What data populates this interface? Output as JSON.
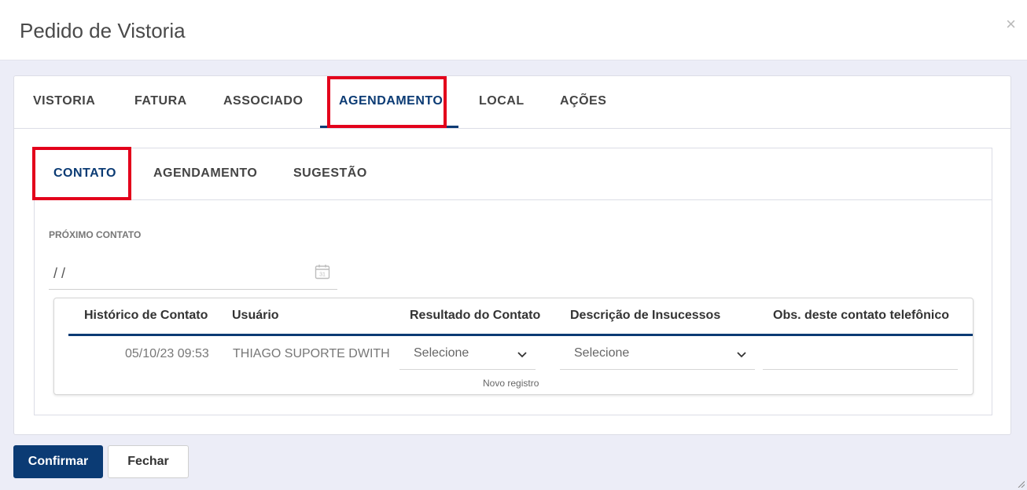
{
  "modal": {
    "title": "Pedido de Vistoria",
    "close_icon": "×"
  },
  "tabs": [
    "VISTORIA",
    "FATURA",
    "ASSOCIADO",
    "AGENDAMENTO",
    "LOCAL",
    "AÇÕES"
  ],
  "active_tab": "AGENDAMENTO",
  "subtabs": [
    "CONTATO",
    "AGENDAMENTO",
    "SUGESTÃO"
  ],
  "active_subtab": "CONTATO",
  "form": {
    "proximo_contato_label": "PRÓXIMO CONTATO",
    "date_value": "/ /"
  },
  "table": {
    "headers": [
      "Histórico de Contato",
      "Usuário",
      "Resultado do Contato",
      "Descrição de Insucessos",
      "Obs. deste contato telefônico"
    ],
    "row": {
      "historico": "05/10/23 09:53",
      "usuario": "THIAGO SUPORTE DWITH",
      "resultado": "Selecione",
      "descricao": "Selecione",
      "obs": ""
    },
    "new_record": "Novo registro"
  },
  "buttons": {
    "confirm": "Confirmar",
    "close": "Fechar"
  },
  "colors": {
    "primary": "#0b3b74",
    "highlight": "#e3001b",
    "background": "#ecedf7"
  }
}
